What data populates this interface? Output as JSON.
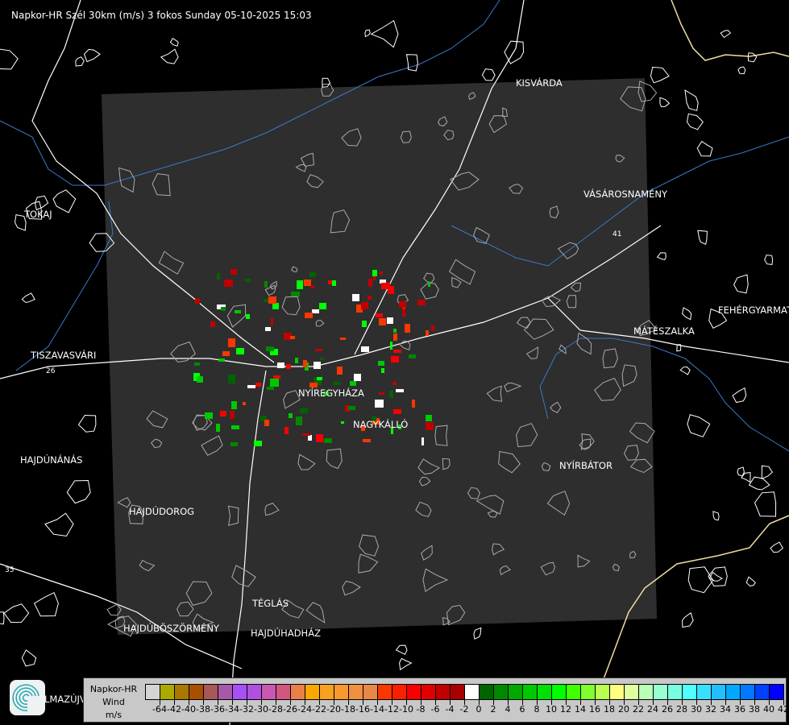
{
  "title": "Napkor-HR Szél 30km (m/s) 3 fokos Sunday 05-10-2025 15:03",
  "cities": [
    {
      "name": "KISVÁRDA"
    },
    {
      "name": "VÁSÁROSNAMÉNY"
    },
    {
      "name": "TOKAJ"
    },
    {
      "name": "FEHÉRGYARMAT"
    },
    {
      "name": "MÁTÉSZALKA"
    },
    {
      "name": "TISZAVASVÁRI"
    },
    {
      "name": "NYÍREGYHÁZA"
    },
    {
      "name": "NAGYKÁLLÓ"
    },
    {
      "name": "HAJDÚNÁNÁS"
    },
    {
      "name": "NYÍRBÁTOR"
    },
    {
      "name": "HAJDÚDOROG"
    },
    {
      "name": "TÉGLÁS"
    },
    {
      "name": "HAJDÚBÖSZÖRMÉNY"
    },
    {
      "name": "HAJDÚHADHÁZ"
    },
    {
      "name": "LMAZÚJVÁROS"
    }
  ],
  "road_numbers": [
    "26",
    "41",
    "35"
  ],
  "legend": {
    "line1": "Napkor-HR",
    "line2": "Wind",
    "unit": "m/s",
    "labels": [
      "-64",
      "-42",
      "-40",
      "-38",
      "-36",
      "-34",
      "-32",
      "-30",
      "-28",
      "-26",
      "-24",
      "-22",
      "-20",
      "-18",
      "-16",
      "-14",
      "-12",
      "-10",
      "-8",
      "-6",
      "-4",
      "-2",
      "0",
      "2",
      "4",
      "6",
      "8",
      "10",
      "12",
      "14",
      "16",
      "18",
      "20",
      "22",
      "24",
      "26",
      "28",
      "30",
      "32",
      "34",
      "36",
      "38",
      "40",
      "42"
    ],
    "colors": [
      "#d4d4d4",
      "#aaaa00",
      "#a87800",
      "#a85000",
      "#a85858",
      "#a858a8",
      "#a850f8",
      "#b050e0",
      "#c858b0",
      "#d05880",
      "#e88048",
      "#f8a800",
      "#f8a020",
      "#f89830",
      "#f09040",
      "#e88848",
      "#f83800",
      "#f82000",
      "#f80000",
      "#e00000",
      "#c00000",
      "#a80000",
      "#ffffff",
      "#006400",
      "#008800",
      "#00a800",
      "#00c800",
      "#00e000",
      "#00ff00",
      "#40ff00",
      "#80ff30",
      "#b8ff50",
      "#ffff80",
      "#e0ffa0",
      "#b8ffb8",
      "#98ffd0",
      "#78ffe0",
      "#50ffff",
      "#38e0ff",
      "#20c0ff",
      "#00a8ff",
      "#0078ff",
      "#0040ff",
      "#0000ff"
    ]
  },
  "colors": {
    "background": "#000000",
    "radar_area": "#2e2e2e",
    "river": "#3a78c8",
    "border": "#f0dca0",
    "road": "#ffffff"
  }
}
